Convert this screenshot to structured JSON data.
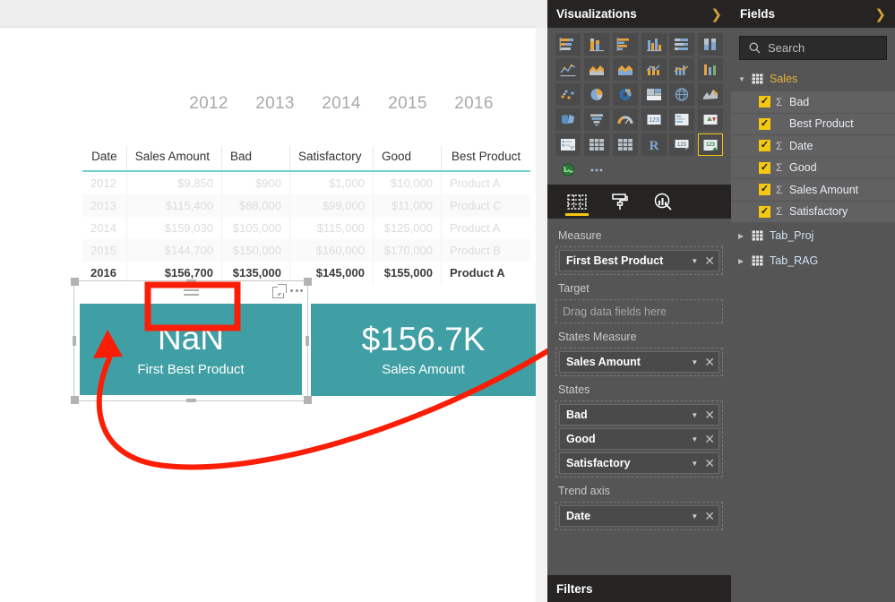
{
  "canvas": {
    "years": [
      "2012",
      "2013",
      "2014",
      "2015",
      "2016"
    ],
    "matrix": {
      "columns": [
        "Date",
        "Sales Amount",
        "Bad",
        "Satisfactory",
        "Good",
        "Best Product"
      ],
      "rows": [
        {
          "cells": [
            "2012",
            "$9,850",
            "$900",
            "$1,000",
            "$10,000",
            "Product A"
          ],
          "state": "faded"
        },
        {
          "cells": [
            "2013",
            "$115,400",
            "$88,000",
            "$99,000",
            "$11,000",
            "Product C"
          ],
          "state": "faded"
        },
        {
          "cells": [
            "2014",
            "$159,030",
            "$105,000",
            "$115,000",
            "$125,000",
            "Product A"
          ],
          "state": "faded"
        },
        {
          "cells": [
            "2015",
            "$144,700",
            "$150,000",
            "$160,000",
            "$170,000",
            "Product B"
          ],
          "state": "faded"
        },
        {
          "cells": [
            "2016",
            "$156,700",
            "$135,000",
            "$145,000",
            "$155,000",
            "Product A"
          ],
          "state": "current"
        }
      ]
    },
    "kpi_first_best_product": {
      "value": "NaN",
      "label": "First Best Product",
      "header_icons": [
        "filter-icon",
        "focus-mode-icon",
        "more-options-icon"
      ],
      "selected": true
    },
    "kpi_sales_amount": {
      "value": "$156.7K",
      "label": "Sales Amount"
    },
    "annotation": {
      "highlight_target": "NaN",
      "arrow": "curved-red-arrow-pointing-to-nan"
    }
  },
  "visualizations": {
    "title": "Visualizations",
    "expand_icon": "chevron-right-icon",
    "gallery": [
      "stacked-bar-chart",
      "stacked-column-chart",
      "clustered-bar-chart",
      "clustered-column-chart",
      "100-percent-stacked-bar-chart",
      "100-percent-stacked-column-chart",
      "line-chart",
      "area-chart",
      "stacked-area-chart",
      "line-and-stacked-column-chart",
      "line-and-clustered-column-chart",
      "ribbon-chart",
      "scatter-chart",
      "pie-chart",
      "donut-chart",
      "treemap",
      "map",
      "filled-map",
      "shape-map",
      "funnel",
      "gauge",
      "card",
      "multi-row-card",
      "kpi-arrows",
      "slicer",
      "table",
      "matrix",
      "r-script-visual",
      "key-influencers",
      "kpi",
      "arcgis-map",
      "more-visuals-ellipsis"
    ],
    "selected_visual": "kpi",
    "tabs": [
      {
        "name": "fields-tab",
        "icon": "fields-grid-icon",
        "active": true
      },
      {
        "name": "format-tab",
        "icon": "paint-roller-icon",
        "active": false
      },
      {
        "name": "analytics-tab",
        "icon": "analytics-magnifier-icon",
        "active": false
      }
    ],
    "wells": [
      {
        "label": "Measure",
        "items": [
          {
            "name": "First Best Product"
          }
        ]
      },
      {
        "label": "Target",
        "placeholder": "Drag data fields here",
        "items": []
      },
      {
        "label": "States Measure",
        "items": [
          {
            "name": "Sales Amount"
          }
        ]
      },
      {
        "label": "States",
        "items": [
          {
            "name": "Bad"
          },
          {
            "name": "Good"
          },
          {
            "name": "Satisfactory"
          }
        ]
      },
      {
        "label": "Trend axis",
        "items": [
          {
            "name": "Date"
          }
        ]
      }
    ],
    "filters_title": "Filters"
  },
  "fields": {
    "title": "Fields",
    "expand_icon": "chevron-right-icon",
    "search_placeholder": "Search",
    "search_icon": "search-icon",
    "tables": [
      {
        "name": "Sales",
        "expanded": true,
        "fields": [
          {
            "name": "Bad",
            "checked": true,
            "aggregate": true
          },
          {
            "name": "Best Product",
            "checked": true,
            "aggregate": false
          },
          {
            "name": "Date",
            "checked": true,
            "aggregate": true
          },
          {
            "name": "Good",
            "checked": true,
            "aggregate": true
          },
          {
            "name": "Sales Amount",
            "checked": true,
            "aggregate": true
          },
          {
            "name": "Satisfactory",
            "checked": true,
            "aggregate": true
          }
        ]
      },
      {
        "name": "Tab_Proj",
        "expanded": false,
        "fields": []
      },
      {
        "name": "Tab_RAG",
        "expanded": false,
        "fields": []
      }
    ]
  },
  "colors": {
    "kpi_teal": "#3f9fa5",
    "accent_yellow": "#f2c811",
    "annotation_red": "#fb1e07",
    "table_header_underline": "#6fd0cf",
    "table_name": "#e8b33c"
  }
}
